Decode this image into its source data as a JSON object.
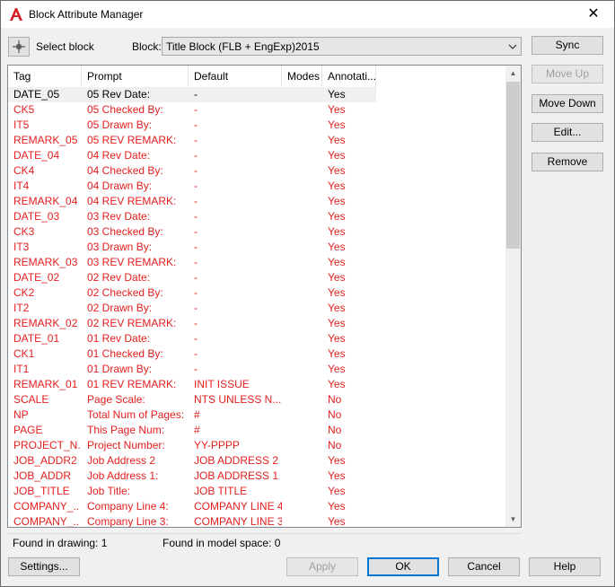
{
  "window": {
    "title": "Block Attribute Manager"
  },
  "toolbar": {
    "select_block_label": "Select block",
    "block_label": "Block:",
    "block_value": "Title Block (FLB + EngExp)2015"
  },
  "table": {
    "headers": [
      "Tag",
      "Prompt",
      "Default",
      "Modes",
      "Annotati..."
    ],
    "rows": [
      [
        "DATE_05",
        "05 Rev Date:",
        "-",
        "",
        "Yes"
      ],
      [
        "CK5",
        "05 Checked By:",
        "-",
        "",
        "Yes"
      ],
      [
        "IT5",
        "05 Drawn By:",
        "-",
        "",
        "Yes"
      ],
      [
        "REMARK_05",
        "05 REV REMARK:",
        "-",
        "",
        "Yes"
      ],
      [
        "DATE_04",
        "04 Rev Date:",
        "-",
        "",
        "Yes"
      ],
      [
        "CK4",
        "04 Checked By:",
        "-",
        "",
        "Yes"
      ],
      [
        "IT4",
        "04 Drawn By:",
        "-",
        "",
        "Yes"
      ],
      [
        "REMARK_04",
        "04 REV REMARK:",
        "-",
        "",
        "Yes"
      ],
      [
        "DATE_03",
        "03 Rev Date:",
        "-",
        "",
        "Yes"
      ],
      [
        "CK3",
        "03 Checked By:",
        "-",
        "",
        "Yes"
      ],
      [
        "IT3",
        "03 Drawn By:",
        "-",
        "",
        "Yes"
      ],
      [
        "REMARK_03",
        "03 REV REMARK:",
        "-",
        "",
        "Yes"
      ],
      [
        "DATE_02",
        "02 Rev Date:",
        "-",
        "",
        "Yes"
      ],
      [
        "CK2",
        "02 Checked By:",
        "-",
        "",
        "Yes"
      ],
      [
        "IT2",
        "02 Drawn By:",
        "-",
        "",
        "Yes"
      ],
      [
        "REMARK_02",
        "02 REV REMARK:",
        "-",
        "",
        "Yes"
      ],
      [
        "DATE_01",
        "01 Rev Date:",
        "-",
        "",
        "Yes"
      ],
      [
        "CK1",
        "01 Checked By:",
        "-",
        "",
        "Yes"
      ],
      [
        "IT1",
        "01 Drawn By:",
        "-",
        "",
        "Yes"
      ],
      [
        "REMARK_01",
        "01 REV REMARK:",
        "INIT ISSUE",
        "",
        "Yes"
      ],
      [
        "SCALE",
        "Page Scale:",
        "NTS UNLESS N...",
        "",
        "No"
      ],
      [
        "NP",
        "Total Num of Pages:",
        "#",
        "",
        "No"
      ],
      [
        "PAGE",
        "This Page Num:",
        "#",
        "",
        "No"
      ],
      [
        "PROJECT_N...",
        "Project Number:",
        "YY-PPPP",
        "",
        "No"
      ],
      [
        "JOB_ADDR2",
        "Job Address 2",
        "JOB ADDRESS 2",
        "",
        "Yes"
      ],
      [
        "JOB_ADDR",
        "Job Address 1:",
        "JOB ADDRESS 1",
        "",
        "Yes"
      ],
      [
        "JOB_TITLE",
        "Job Title:",
        "JOB TITLE",
        "",
        "Yes"
      ],
      [
        "COMPANY_...",
        "Company Line 4:",
        "COMPANY LINE 4",
        "",
        "Yes"
      ],
      [
        "COMPANY_...",
        "Company Line 3:",
        "COMPANY LINE 3",
        "",
        "Yes"
      ]
    ]
  },
  "side_buttons": {
    "sync": "Sync",
    "move_up": "Move Up",
    "move_down": "Move Down",
    "edit": "Edit...",
    "remove": "Remove"
  },
  "status": {
    "found_in_drawing": "Found in drawing: 1",
    "found_in_model_space": "Found in model space: 0"
  },
  "bottom_buttons": {
    "settings": "Settings...",
    "apply": "Apply",
    "ok": "OK",
    "cancel": "Cancel",
    "help": "Help"
  },
  "colors": {
    "attribute_text": "#e41e1e",
    "selected_text": "#000000",
    "default_button_border": "#0078d7"
  }
}
